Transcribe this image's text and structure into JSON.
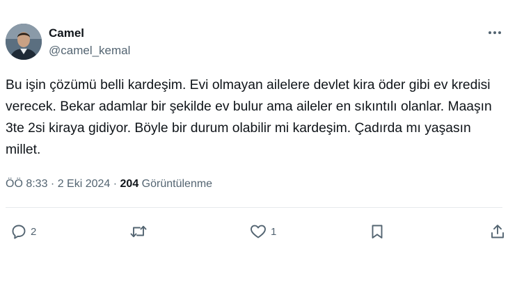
{
  "author": {
    "display_name": "Camel",
    "handle": "@camel_kemal",
    "avatar_icon": "profile-photo"
  },
  "tweet": {
    "text": "Bu işin çözümü belli kardeşim. Evi olmayan ailelere devlet kira öder gibi ev kredisi verecek. Bekar adamlar bir şekilde ev bulur ama aileler en sıkıntılı olanlar. Maaşın 3te 2si kiraya gidiyor. Böyle bir durum olabilir mi kardeşim. Çadırda mı yaşasın millet.",
    "time": "ÖÖ 8:33 · 2 Eki 2024 · ",
    "views_count": "204",
    "views_label": " Görüntülenme"
  },
  "actions": {
    "reply_count": "2",
    "retweet_count": "",
    "like_count": "1"
  },
  "colors": {
    "text_primary": "#0f1419",
    "text_secondary": "#536471",
    "divider": "#e6e9ec"
  }
}
